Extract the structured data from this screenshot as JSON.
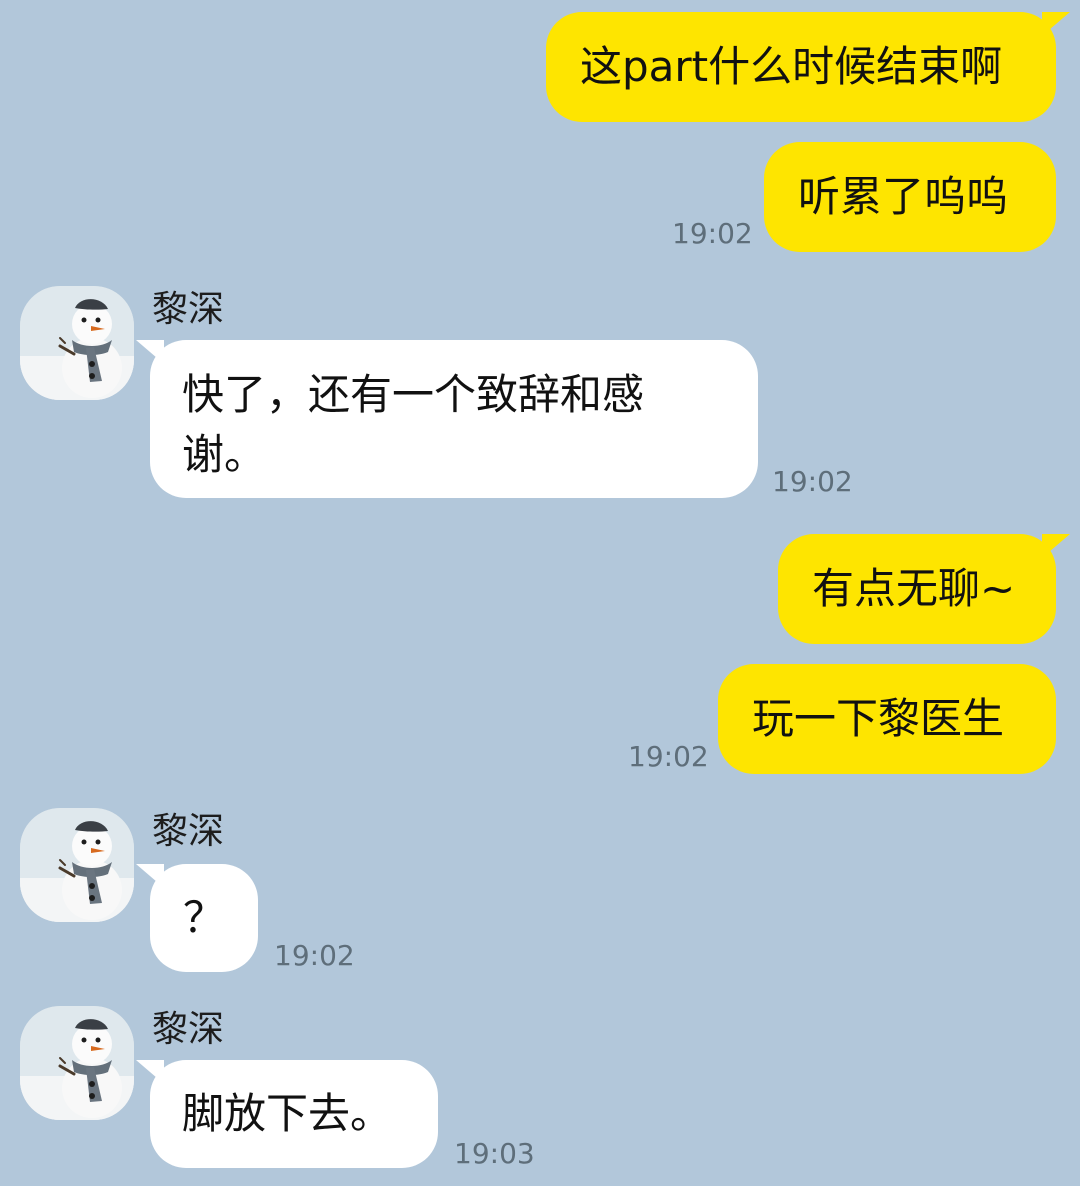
{
  "contact": {
    "name": "黎深"
  },
  "messages": [
    {
      "direction": "outgoing",
      "text": "这part什么时候结束啊"
    },
    {
      "direction": "outgoing",
      "text": "听累了呜呜",
      "time": "19:02"
    },
    {
      "direction": "incoming",
      "sender": "黎深",
      "text": "快了，还有一个致辞和感谢。",
      "time": "19:02"
    },
    {
      "direction": "outgoing",
      "text": "有点无聊~"
    },
    {
      "direction": "outgoing",
      "text": "玩一下黎医生",
      "time": "19:02"
    },
    {
      "direction": "incoming",
      "sender": "黎深",
      "text": "？",
      "time": "19:02"
    },
    {
      "direction": "incoming",
      "sender": "黎深",
      "text": "脚放下去。",
      "time": "19:03"
    }
  ],
  "colors": {
    "background": "#b2c7da",
    "outgoing_bubble": "#fee500",
    "incoming_bubble": "#ffffff",
    "timestamp": "#5e6e7a"
  },
  "icons": {
    "avatar": "snowman-avatar-icon"
  }
}
